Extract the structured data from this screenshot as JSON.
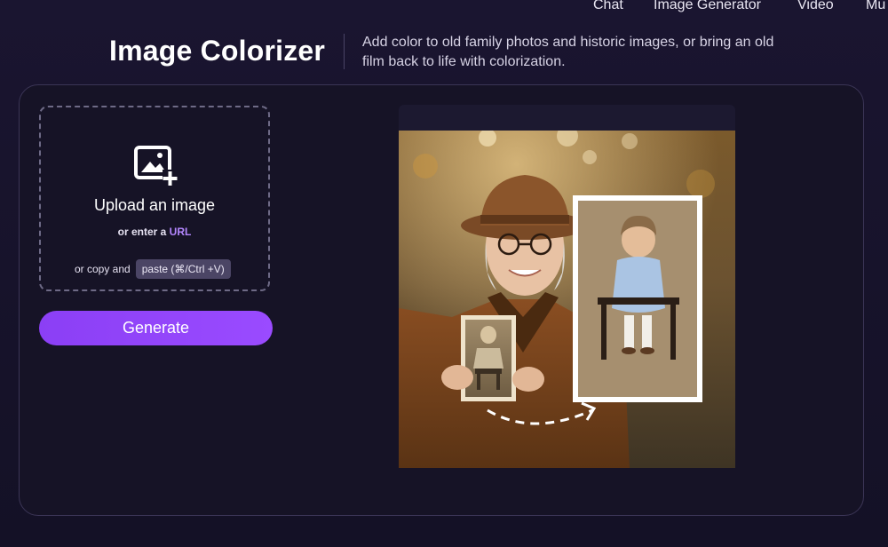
{
  "nav": {
    "items": [
      "Chat",
      "Image Generator",
      "Video",
      "Mu"
    ]
  },
  "header": {
    "title": "Image Colorizer",
    "subtitle": "Add color to old family photos and historic images, or bring an old film back to life with colorization."
  },
  "upload": {
    "icon": "image-add-icon",
    "label": "Upload an image",
    "or_enter": "or enter a",
    "url_link": "URL",
    "copy_prefix": "or copy and",
    "paste_hint": "paste (⌘/Ctrl +V)"
  },
  "generate": {
    "label": "Generate"
  },
  "colors": {
    "accent": "#9a4bff",
    "background": "#141126",
    "link": "#b487ff"
  }
}
